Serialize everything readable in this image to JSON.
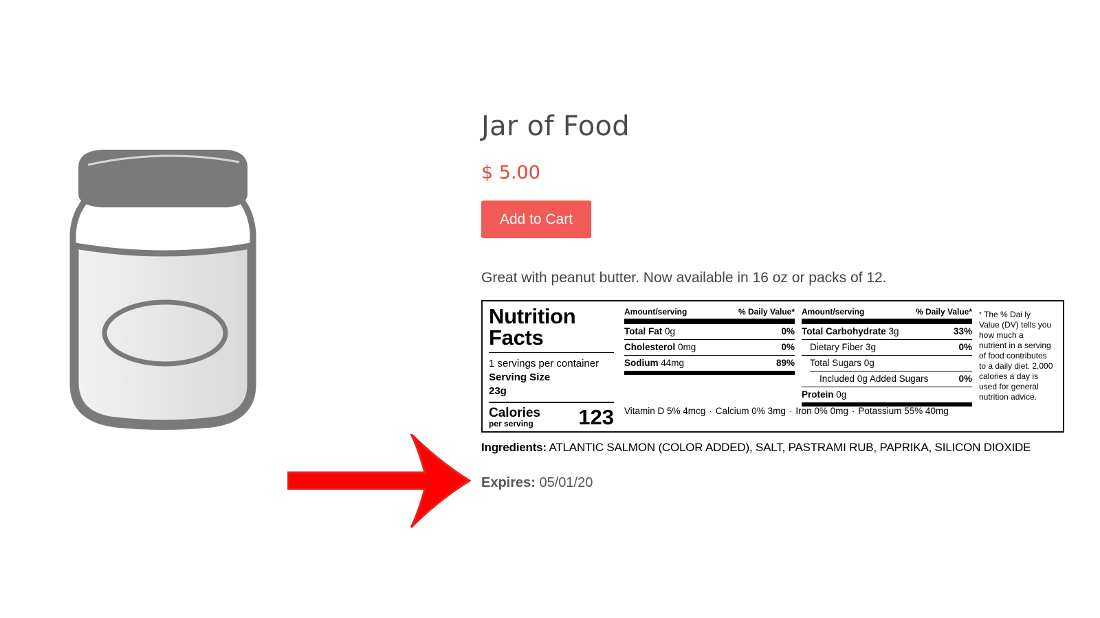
{
  "product": {
    "title": "Jar of Food",
    "price": "$ 5.00",
    "add_to_cart_label": "Add to Cart",
    "description": "Great with peanut butter. Now available in 16 oz or packs of 12."
  },
  "nutrition": {
    "title_line1": "Nutrition",
    "title_line2": "Facts",
    "servings": "1 servings per container",
    "serving_size_label": "Serving Size",
    "serving_size_value": "23g",
    "calories_label": "Calories",
    "calories_sub": "per serving",
    "calories_value": "123",
    "header_amount": "Amount/serving",
    "header_dv": "% Daily Value*",
    "col1": [
      {
        "name": "Total Fat",
        "amount": "0g",
        "dv": "0%"
      },
      {
        "name": "Cholesterol",
        "amount": "0mg",
        "dv": "0%"
      },
      {
        "name": "Sodium",
        "amount": "44mg",
        "dv": "89%"
      }
    ],
    "col2": [
      {
        "name": "Total Carbohydrate",
        "amount": "3g",
        "dv": "33%"
      },
      {
        "name": "Dietary Fiber 3g",
        "amount": "",
        "dv": "0%"
      },
      {
        "name": "Total Sugars 0g",
        "amount": "",
        "dv": ""
      },
      {
        "name": "Included 0g Added Sugars",
        "amount": "",
        "dv": "0%"
      },
      {
        "name": "Protein",
        "amount": "0g",
        "dv": ""
      }
    ],
    "vitamins": [
      "Vitamin D 5% 4mcg",
      "Calcium 0% 3mg",
      "Iron 0% 0mg",
      "Potassium 55% 40mg"
    ],
    "vitamin_separator": "·",
    "footnote_star": "*",
    "footnote": "The % Dai ly Value (DV) tells you how much a nutrient in a serving of food contributes to a daily diet. 2,000 calories a day is used for general nutrition advice."
  },
  "ingredients": {
    "label": "Ingredients:",
    "value": "ATLANTIC SALMON (COLOR ADDED), SALT, PASTRAMI RUB, PAPRIKA, SILICON DIOXIDE"
  },
  "expires": {
    "label": "Expires:",
    "value": "05/01/20"
  },
  "annotation": {
    "arrow_color": "#ff0000"
  }
}
